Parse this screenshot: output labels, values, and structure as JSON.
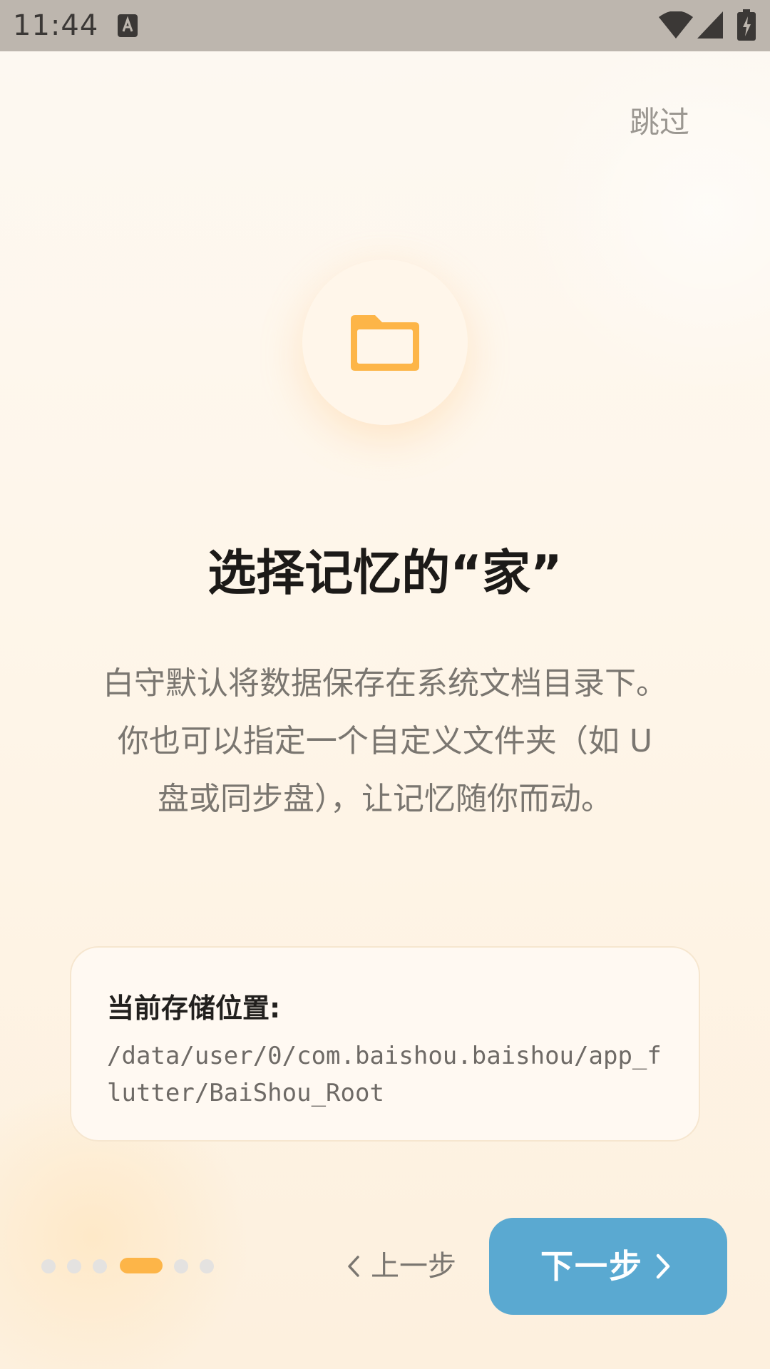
{
  "status_bar": {
    "time": "11:44"
  },
  "skip_label": "跳过",
  "title": "选择记忆的“家”",
  "description": "白守默认将数据保存在系统文档目录下。你也可以指定一个自定义文件夹（如 U 盘或同步盘），让记忆随你而动。",
  "storage": {
    "label": "当前存储位置:",
    "path": "/data/user/0/com.baishou.baishou/app_flutter/BaiShou_Root"
  },
  "pager": {
    "total": 6,
    "active_index": 3
  },
  "nav": {
    "back_label": "上一步",
    "next_label": "下一步"
  },
  "colors": {
    "accent": "#fdb548",
    "primary_button": "#5aa9d1",
    "status_bar": "#bdb6ae"
  },
  "icons": [
    "folder-icon",
    "chevron-left-icon",
    "chevron-right-icon",
    "wifi-icon",
    "signal-icon",
    "battery-icon"
  ]
}
